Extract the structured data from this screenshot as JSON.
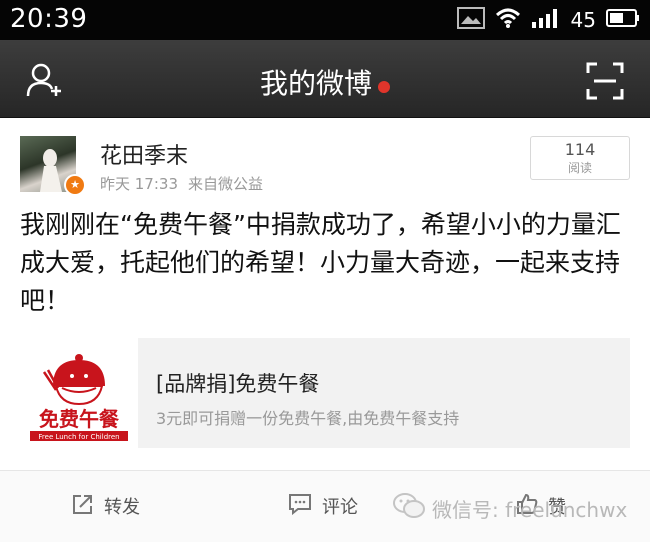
{
  "status_bar": {
    "time": "20:39",
    "battery_level": "45",
    "icons": [
      "image-icon",
      "wifi-icon",
      "signal-icon",
      "battery-icon"
    ]
  },
  "header": {
    "title": "我的微博",
    "left_icon": "add-friend-icon",
    "right_icon": "scan-icon",
    "notify_dot_color": "#e0352b"
  },
  "post": {
    "user_name": "花田季末",
    "time": "昨天 17:33",
    "source": "来自微公益",
    "read_count": "114",
    "read_label": "阅读",
    "text": "我刚刚在“免费午餐”中捐款成功了，希望小小的力量汇成大爱，托起他们的希望！小力量大奇迹，一起来支持吧！",
    "share": {
      "logo_text": "免费午餐",
      "logo_subtext": "Free Lunch for Children",
      "title": "[品牌捐]免费午餐",
      "description": "3元即可捐赠一份免费午餐,由免费午餐支持",
      "brand_color": "#c8141c"
    }
  },
  "actions": {
    "repost": "转发",
    "comment": "评论",
    "like": "赞"
  },
  "watermark": {
    "text": "微信号: freelunchwx"
  }
}
